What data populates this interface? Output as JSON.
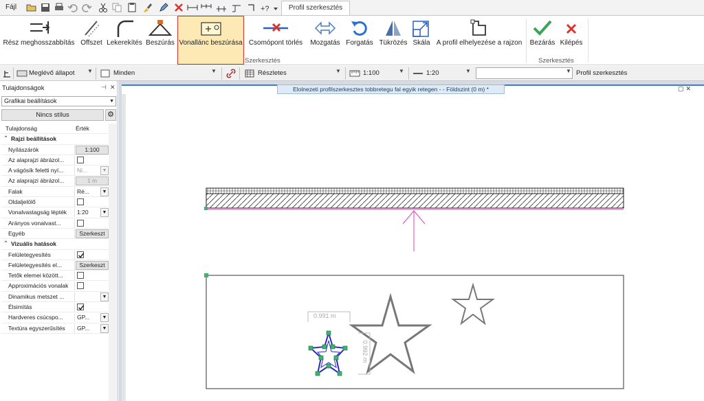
{
  "quick_access": {
    "file_label": "Fájl",
    "profile_tab": "Profil szerkesztés"
  },
  "ribbon": {
    "buttons": [
      {
        "label": "Rész meghosszabbítás",
        "icon": "extend-icon"
      },
      {
        "label": "Offszet",
        "icon": "offset-icon"
      },
      {
        "label": "Lekerekítés",
        "icon": "fillet-icon"
      },
      {
        "label": "Beszúrás",
        "icon": "insert-node-icon"
      },
      {
        "label": "Vonallánc beszúrása",
        "icon": "insert-polyline-icon",
        "active": true
      },
      {
        "label": "Csomópont törlés",
        "icon": "delete-node-icon"
      },
      {
        "label": "Mozgatás",
        "icon": "move-icon"
      },
      {
        "label": "Forgatás",
        "icon": "rotate-icon"
      },
      {
        "label": "Tükrözés",
        "icon": "mirror-icon"
      },
      {
        "label": "Skála",
        "icon": "scale-icon"
      },
      {
        "label": "A profil elhelyezése a rajzon",
        "icon": "place-profile-icon"
      },
      {
        "label": "Bezárás",
        "icon": "checkmark-icon"
      },
      {
        "label": "Kilépés",
        "icon": "cross-icon"
      }
    ],
    "group1_label": "Szerkesztés",
    "group2_label": "Szerkesztés"
  },
  "toolbar": {
    "state": "Meglévő állapot",
    "filter": "Minden",
    "detail": "Részletes",
    "scale1": "1:100",
    "scale2": "1:20",
    "mode_input": "",
    "mode_label": "Profil szerkesztés"
  },
  "panel": {
    "title": "Tulajdonságok",
    "pin": "⊣",
    "close": "✕",
    "category": "Grafikai beállítások",
    "style_button": "Nincs stílus",
    "col_property": "Tulajdonság",
    "col_value": "Érték",
    "rows": [
      {
        "type": "section",
        "label": "Rajzi beállítások"
      },
      {
        "type": "button",
        "label": "Nyílászárók",
        "value": "1:100"
      },
      {
        "type": "check",
        "label": "Az alaprajzi ábrázol...",
        "checked": false
      },
      {
        "type": "select",
        "label": "A vágósík feletti nyí...",
        "value": "Ni...",
        "disabled": true
      },
      {
        "type": "button",
        "label": "Az alaprajzi ábrázol...",
        "value": "1 m",
        "disabled": true
      },
      {
        "type": "select",
        "label": "Falak",
        "value": "Ré..."
      },
      {
        "type": "check",
        "label": "Oldaljelölő",
        "checked": false
      },
      {
        "type": "select",
        "label": "Vonalvastagság lépték",
        "value": "1:20"
      },
      {
        "type": "check",
        "label": "Arányos vonalvast...",
        "checked": false
      },
      {
        "type": "button",
        "label": "Egyéb",
        "value": "Szerkeszt"
      },
      {
        "type": "section",
        "label": "Vizuális hatások"
      },
      {
        "type": "check",
        "label": "Felületegyesítés",
        "checked": true
      },
      {
        "type": "button",
        "label": "Felületegyesítés el...",
        "value": "Szerkeszt"
      },
      {
        "type": "check",
        "label": "Tetők elemei között...",
        "checked": false
      },
      {
        "type": "check",
        "label": "Approximációs vonalak",
        "checked": false
      },
      {
        "type": "select",
        "label": "Dinamikus metszet ...",
        "value": ""
      },
      {
        "type": "check",
        "label": "Élsimítás",
        "checked": true
      },
      {
        "type": "select",
        "label": "Hardveres csúcspo...",
        "value": "GP..."
      },
      {
        "type": "select",
        "label": "Textúra egyszerűsítés",
        "value": "GP..."
      }
    ]
  },
  "document": {
    "title": "Elolnezeti profilszerkesztes tobbretegu fal egyik retegen -  - Földszint (0 m) *",
    "window_controls": "▢✕",
    "dim_horizontal": "0.991 m",
    "dim_vertical": "0.992 m"
  },
  "colors": {
    "accent": "#d9342b",
    "active_bg": "#fde9b3",
    "magenta": "#e040c0",
    "node_green": "#3cb371",
    "profile_blue": "#2b2bc4",
    "check_green": "#3aa655",
    "cross_red": "#d9342b"
  }
}
